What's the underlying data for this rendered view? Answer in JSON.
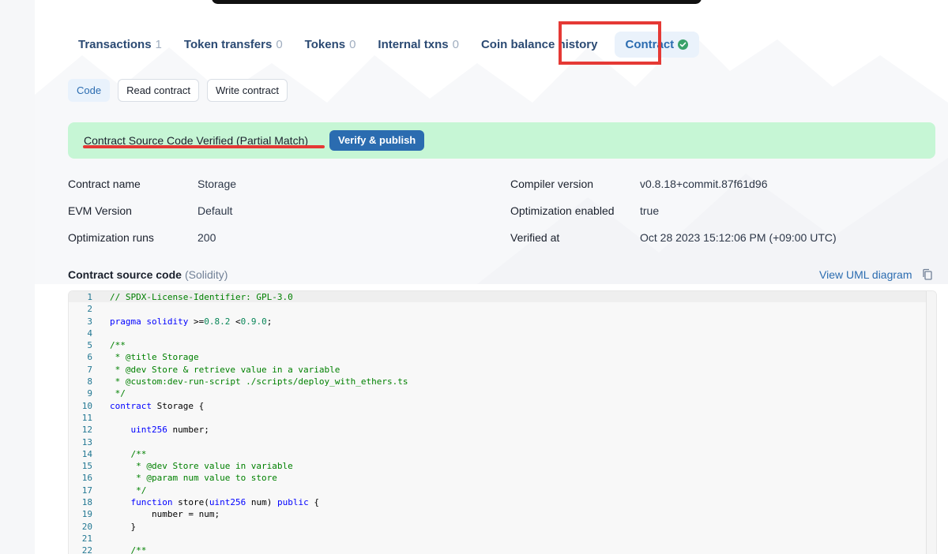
{
  "tabs": [
    {
      "label": "Transactions",
      "count": "1"
    },
    {
      "label": "Token transfers",
      "count": "0"
    },
    {
      "label": "Tokens",
      "count": "0"
    },
    {
      "label": "Internal txns",
      "count": "0"
    },
    {
      "label": "Coin balance history",
      "count": ""
    },
    {
      "label": "Contract",
      "count": "",
      "active": true,
      "verified_icon": "check-circle-icon"
    }
  ],
  "subtabs": [
    "Code",
    "Read contract",
    "Write contract"
  ],
  "banner": {
    "text": "Contract Source Code Verified (Partial Match)",
    "button": "Verify & publish"
  },
  "details": {
    "contract_name_label": "Contract name",
    "contract_name": "Storage",
    "evm_label": "EVM Version",
    "evm": "Default",
    "runs_label": "Optimization runs",
    "runs": "200",
    "compiler_label": "Compiler version",
    "compiler": "v0.8.18+commit.87f61d96",
    "optimization_label": "Optimization enabled",
    "optimization": "true",
    "verified_label": "Verified at",
    "verified": "Oct 28 2023 15:12:06 PM (+09:00 UTC)"
  },
  "source": {
    "title": "Contract source code",
    "language": "(Solidity)",
    "uml_link": "View UML diagram",
    "copy_icon": "copy-icon"
  },
  "code_lines": [
    "// SPDX-License-Identifier: GPL-3.0",
    "",
    "pragma solidity >=0.8.2 <0.9.0;",
    "",
    "/**",
    " * @title Storage",
    " * @dev Store & retrieve value in a variable",
    " * @custom:dev-run-script ./scripts/deploy_with_ethers.ts",
    " */",
    "contract Storage {",
    "",
    "    uint256 number;",
    "",
    "    /**",
    "     * @dev Store value in variable",
    "     * @param num value to store",
    "     */",
    "    function store(uint256 num) public {",
    "        number = num;",
    "    }",
    "",
    "    /**"
  ],
  "colors": {
    "accent": "#2b6cb0",
    "banner_bg": "#c6f6d5",
    "annotation_red": "#e53935",
    "verified_green": "#38a169"
  }
}
